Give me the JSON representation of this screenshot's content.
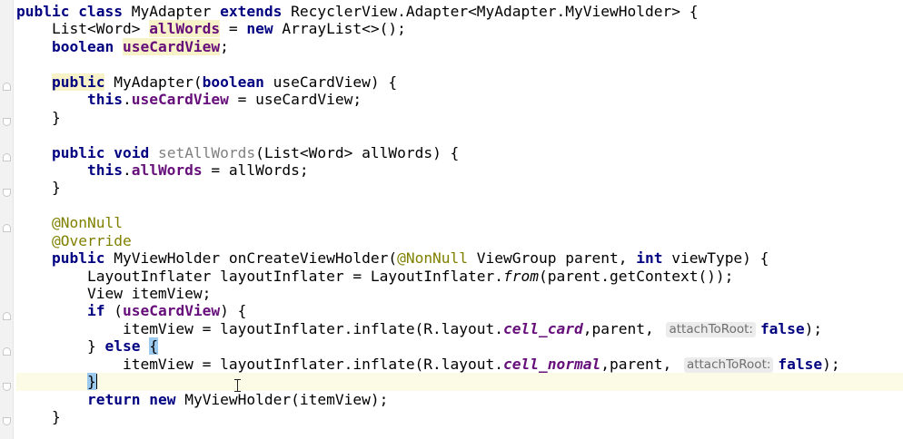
{
  "editor": {
    "language": "Java",
    "current_line_index": 21,
    "parameter_hint_label": "attachToRoot:"
  },
  "tokens": {
    "public": "public",
    "class": "class",
    "extends": "extends",
    "new": "new",
    "boolean": "boolean",
    "this": "this",
    "void": "void",
    "int": "int",
    "if": "if",
    "else": "else",
    "return": "return",
    "false": "false",
    "class_decl_name": " MyAdapter ",
    "class_decl_super": " RecyclerView.Adapter<MyAdapter.MyViewHolder> {",
    "list_type": "List<Word> ",
    "field_allWords": "allWords",
    "assign_new": " = ",
    "arraylist": " ArrayList<>();",
    "field_useCardView": "useCardView",
    "semicolon": ";",
    "ctor_sig_a": " MyAdapter(",
    "ctor_sig_b": " useCardView) {",
    "dot": ".",
    "ctor_body_tail": " = useCardView;",
    "close_brace": "}",
    "method_set": "setAllWords",
    "method_set_params": "(List<Word> allWords) {",
    "set_body_tail": " = allWords;",
    "ann_nonnull": "@NonNull",
    "ann_override": "@Override",
    "oncreate_a": " MyViewHolder onCreateViewHolder(",
    "oncreate_b": " ViewGroup parent, ",
    "oncreate_c": " viewType) {",
    "inflater_a": "LayoutInflater layoutInflater = LayoutInflater.",
    "inflater_from": "from",
    "inflater_b": "(parent.getContext());",
    "itemview_decl": "View itemView;",
    "if_open": " (",
    "if_close": ") {",
    "inflate_call": "itemView = layoutInflater.inflate(R.layout.",
    "cell_card": "cell_card",
    "cell_normal": "cell_normal",
    "parent_arg": ",parent, ",
    "call_end": ");",
    "else_a": "} ",
    "open_brace": "{",
    "return_a": " ",
    "return_b": " MyViewHolder(itemView);"
  }
}
